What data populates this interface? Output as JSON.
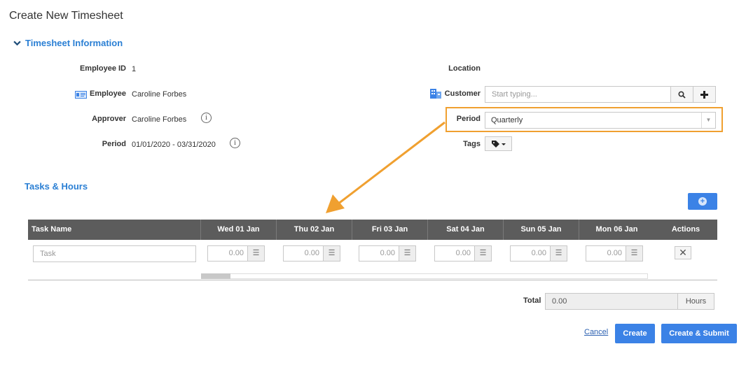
{
  "page": {
    "title": "Create New Timesheet"
  },
  "info_section": {
    "title": "Timesheet Information",
    "employee_id_label": "Employee ID",
    "employee_id_value": "1",
    "employee_label": "Employee",
    "employee_value": "Caroline Forbes",
    "approver_label": "Approver",
    "approver_value": "Caroline Forbes",
    "period_label": "Period",
    "period_value": "01/01/2020 - 03/31/2020",
    "location_label": "Location",
    "customer_label": "Customer",
    "customer_placeholder": "Start typing...",
    "period_select_label": "Period",
    "period_select_value": "Quarterly",
    "tags_label": "Tags"
  },
  "tasks_section": {
    "title": "Tasks & Hours",
    "columns": [
      "Task Name",
      "Wed 01 Jan",
      "Thu 02 Jan",
      "Fri 03 Jan",
      "Sat 04 Jan",
      "Sun 05 Jan",
      "Mon 06 Jan",
      "Actions"
    ],
    "task_placeholder": "Task",
    "hours": [
      "0.00",
      "0.00",
      "0.00",
      "0.00",
      "0.00",
      "0.00"
    ]
  },
  "totals": {
    "label": "Total",
    "value": "0.00",
    "unit": "Hours"
  },
  "footer": {
    "cancel": "Cancel",
    "create": "Create",
    "create_submit": "Create & Submit"
  },
  "colors": {
    "accent": "#3b82e6",
    "highlight": "#f0a030",
    "header_bg": "#5c5c5c",
    "section_title": "#2a7fd4"
  },
  "icons": [
    "chevron-down-icon",
    "id-card-icon",
    "building-icon",
    "info-icon",
    "search-icon",
    "plus-icon",
    "tag-icon",
    "plus-circle-icon",
    "menu-lines-icon",
    "close-icon"
  ]
}
